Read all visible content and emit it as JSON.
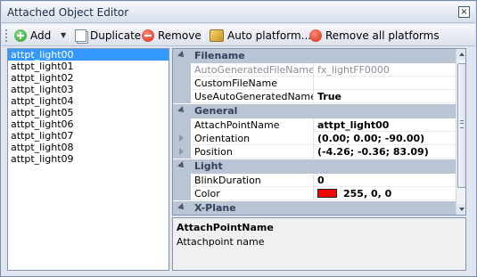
{
  "window": {
    "title": "Attached Object Editor",
    "close_glyph": "×"
  },
  "toolbar": {
    "add_label": "Add",
    "duplicate_label": "Duplicate",
    "remove_label": "Remove",
    "auto_platform_label": "Auto platform...",
    "remove_all_label": "Remove all platforms"
  },
  "list": {
    "items": [
      "attpt_light00",
      "attpt_light01",
      "attpt_light02",
      "attpt_light03",
      "attpt_light04",
      "attpt_light05",
      "attpt_light06",
      "attpt_light07",
      "attpt_light08",
      "attpt_light09"
    ],
    "selected_index": 0
  },
  "grid": {
    "categories": {
      "filename": "Filename",
      "general": "General",
      "light": "Light",
      "xplane": "X-Plane"
    },
    "rows": {
      "auto_generated_file_name": {
        "name": "AutoGeneratedFileName",
        "value": "fx_lightFF0000"
      },
      "custom_file_name": {
        "name": "CustomFileName",
        "value": ""
      },
      "use_auto_generated_name": {
        "name": "UseAutoGeneratedName",
        "value": "True"
      },
      "attach_point_name": {
        "name": "AttachPointName",
        "value": "attpt_light00"
      },
      "orientation": {
        "name": "Orientation",
        "value": "(0.00; 0.00; -90.00)"
      },
      "position": {
        "name": "Position",
        "value": "(-4.26; -0.36; 83.09)"
      },
      "blink_duration": {
        "name": "BlinkDuration",
        "value": "0"
      },
      "color": {
        "name": "Color",
        "value": "255, 0, 0",
        "swatch": "#ff0000"
      }
    }
  },
  "help": {
    "title": "AttachPointName",
    "description": "Attachpoint name"
  },
  "colors": {
    "selection": "#3399ff",
    "category_bg": "#b9c4d4",
    "window_bg": "#dfe6f0"
  }
}
